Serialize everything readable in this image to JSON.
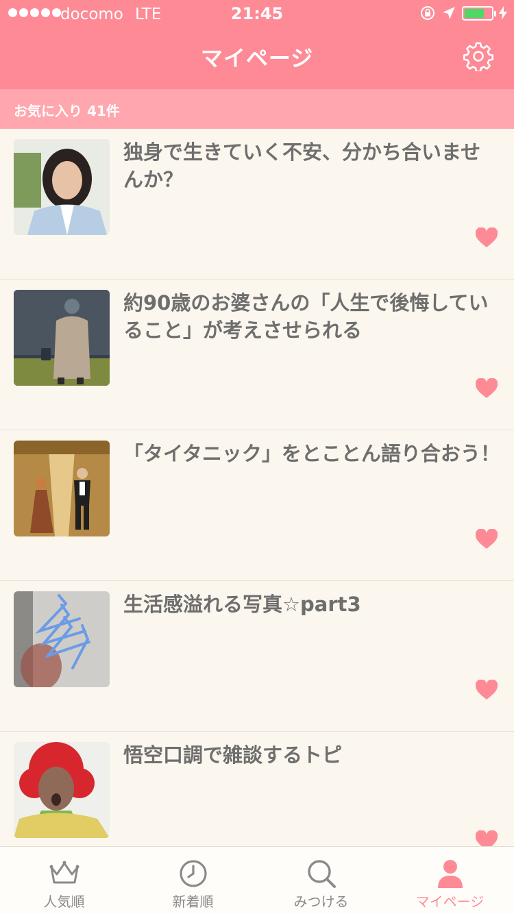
{
  "status_bar": {
    "carrier": "docomo",
    "network": "LTE",
    "time": "21:45"
  },
  "nav": {
    "title": "マイページ",
    "settings_icon": "gear-icon"
  },
  "favorites_bar": {
    "label": "お気に入り 41件"
  },
  "topics": [
    {
      "title": "独身で生きていく不安、分かち合いませんか？",
      "thumb": "woman-portrait",
      "favorited": true
    },
    {
      "title": "約90歳のお婆さんの「人生で後悔していること」が考えさせられる",
      "thumb": "elderly-woman-walking",
      "favorited": true
    },
    {
      "title": "「タイタニック」をとことん語り合おう！",
      "thumb": "couple-corridor",
      "favorited": true
    },
    {
      "title": "生活感溢れる写真☆part3",
      "thumb": "blue-hangers",
      "favorited": true
    },
    {
      "title": "悟空口調で雑談するトピ",
      "thumb": "red-wig-person",
      "favorited": true
    }
  ],
  "tabs": [
    {
      "label": "人気順",
      "icon": "crown-icon",
      "active": false
    },
    {
      "label": "新着順",
      "icon": "clock-icon",
      "active": false
    },
    {
      "label": "みつける",
      "icon": "search-icon",
      "active": false
    },
    {
      "label": "マイページ",
      "icon": "person-icon",
      "active": true
    }
  ],
  "colors": {
    "accent": "#fe8a96",
    "subbar": "#ffa6ae",
    "background": "#fbf6ee",
    "text": "#6e6e6e"
  }
}
